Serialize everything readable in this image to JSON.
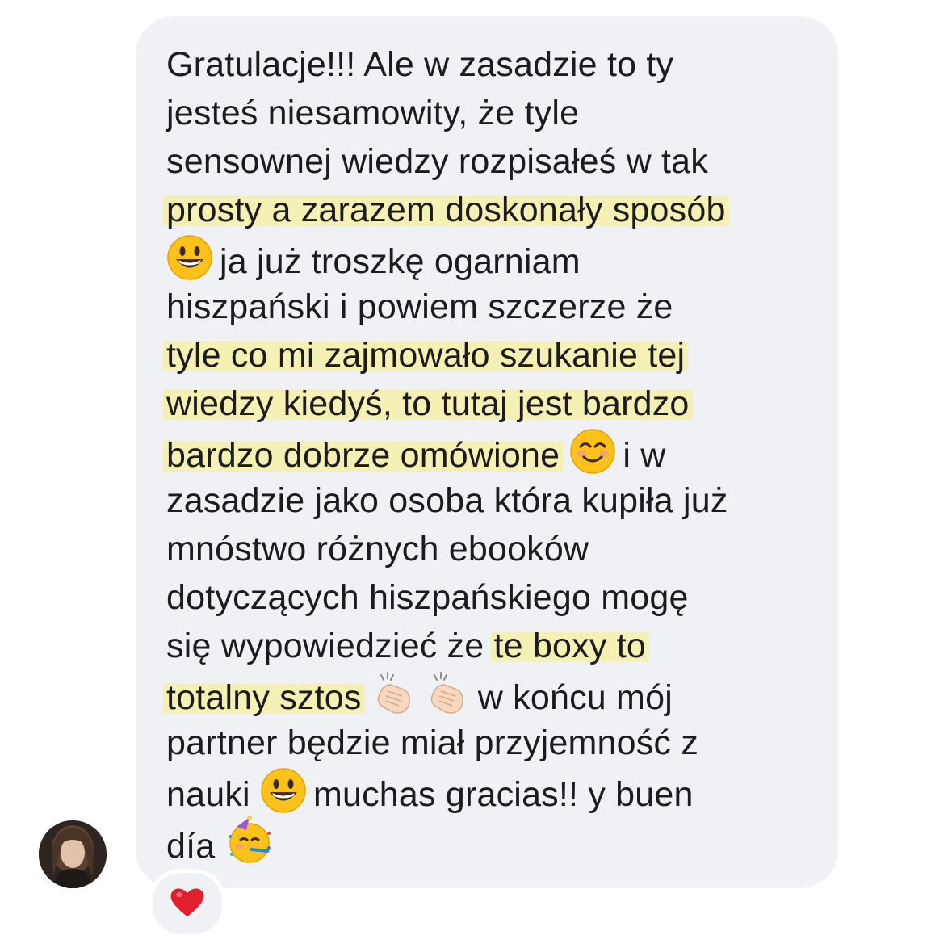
{
  "message": {
    "lines": [
      [
        "Gratulacje!!! Ale w zasadzie to ty"
      ],
      [
        "jesteś niesamowity, że tyle"
      ],
      [
        "sensownej wiedzy rozpisałeś w tak"
      ],
      [
        "prosty a zarazem doskonały sposób"
      ],
      [
        "ja już troszkę ogarniam"
      ],
      [
        "hiszpański i powiem szczerze że"
      ],
      [
        "tyle co mi zajmowało szukanie tej"
      ],
      [
        "wiedzy kiedyś, to tutaj jest bardzo"
      ],
      [
        "bardzo dobrze omówione",
        "i w"
      ],
      [
        "zasadzie jako osoba która kupiła już"
      ],
      [
        "mnóstwo różnych ebooków"
      ],
      [
        "dotyczących hiszpańskiego mogę"
      ],
      [
        "się wypowiedzieć że",
        "te boxy to"
      ],
      [
        "totalny sztos",
        "w końcu mój"
      ],
      [
        "partner będzie miał przyjemność z"
      ],
      [
        "nauki",
        "muchas gracias!! y buen"
      ],
      [
        "día"
      ]
    ],
    "highlight_color": "#f5f1b5",
    "bubble_color": "#f0f1f4",
    "text_color": "#1c1c1e"
  },
  "emojis": {
    "grin": "grinning-face-icon",
    "smile": "smiling-face-icon",
    "clap": "clapping-hands-icon",
    "party": "partying-face-icon"
  },
  "reaction": {
    "icon": "heart-icon",
    "color": "#e0202e"
  },
  "avatar": {
    "icon": "user-avatar"
  }
}
